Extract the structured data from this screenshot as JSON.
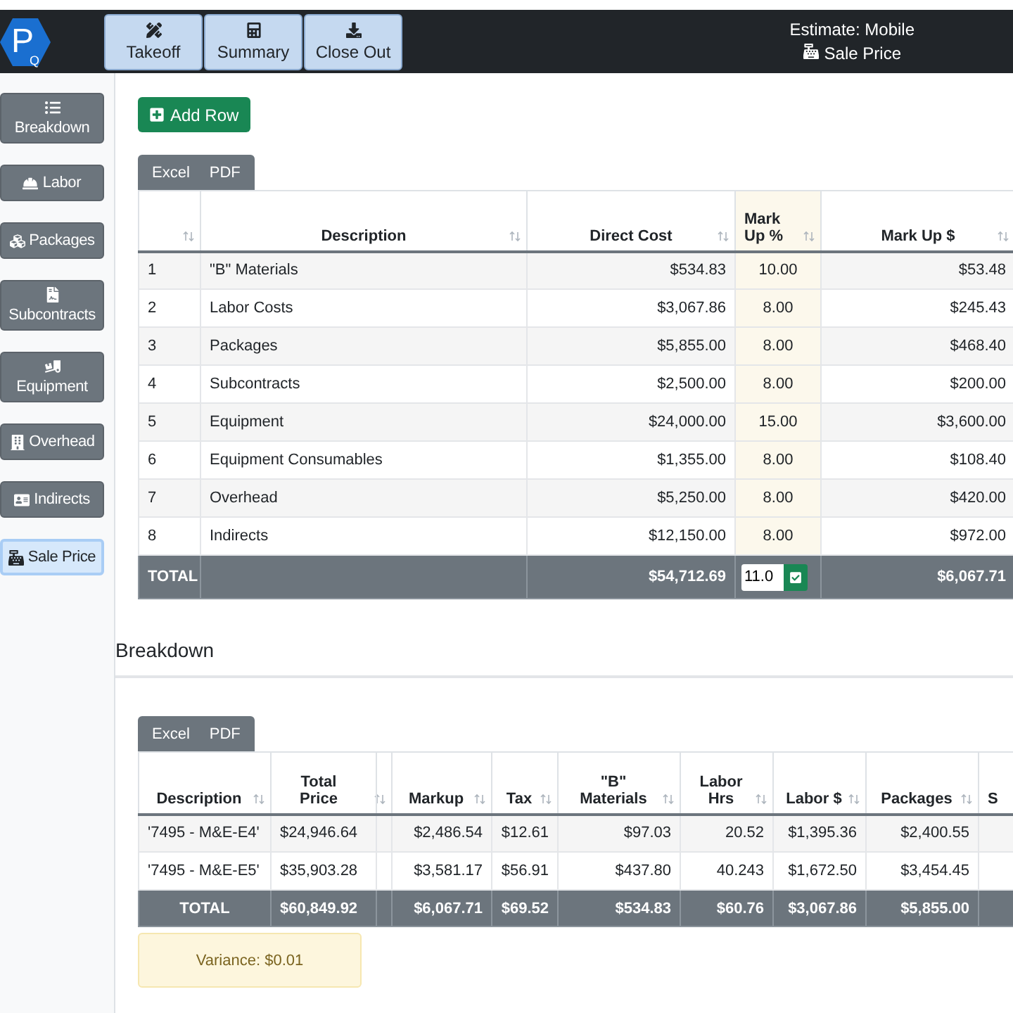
{
  "logo": {
    "letter": "P",
    "sub": "Q"
  },
  "nav": [
    {
      "label": "Takeoff",
      "selected": false
    },
    {
      "label": "Summary",
      "selected": false
    },
    {
      "label": "Close Out",
      "selected": false
    }
  ],
  "header": {
    "estimate": "Estimate: Mobile",
    "page": "Sale Price"
  },
  "sidebar": {
    "items": [
      {
        "label": "Breakdown",
        "kind": "stacked",
        "selected": false
      },
      {
        "label": "Labor",
        "kind": "inline",
        "selected": false
      },
      {
        "label": "Packages",
        "kind": "inline",
        "selected": false
      },
      {
        "label": "Subcontracts",
        "kind": "stacked",
        "selected": false
      },
      {
        "label": "Equipment",
        "kind": "stacked",
        "selected": false
      },
      {
        "label": "Overhead",
        "kind": "inline",
        "selected": false
      },
      {
        "label": "Indirects",
        "kind": "inline",
        "selected": false
      },
      {
        "label": "Sale Price",
        "kind": "inline",
        "selected": true
      }
    ]
  },
  "add_row": "Add Row",
  "markup_table": {
    "exports": [
      "Excel",
      "PDF"
    ],
    "columns": [
      {
        "kind": "index"
      },
      {
        "label": "Description",
        "kind": "text"
      },
      {
        "label": "Direct Cost",
        "kind": "money"
      },
      {
        "label": "Mark Up %",
        "kind": "editable"
      },
      {
        "label": "Mark Up $",
        "kind": "money"
      }
    ],
    "rows": [
      [
        "1",
        "\"B\" Materials",
        "$534.83",
        "10.00",
        "$53.48"
      ],
      [
        "2",
        "Labor Costs",
        "$3,067.86",
        "8.00",
        "$245.43"
      ],
      [
        "3",
        "Packages",
        "$5,855.00",
        "8.00",
        "$468.40"
      ],
      [
        "4",
        "Subcontracts",
        "$2,500.00",
        "8.00",
        "$200.00"
      ],
      [
        "5",
        "Equipment",
        "$24,000.00",
        "15.00",
        "$3,600.00"
      ],
      [
        "6",
        "Equipment Consumables",
        "$1,355.00",
        "8.00",
        "$108.40"
      ],
      [
        "7",
        "Overhead",
        "$5,250.00",
        "8.00",
        "$420.00"
      ],
      [
        "8",
        "Indirects",
        "$12,150.00",
        "8.00",
        "$972.00"
      ]
    ],
    "total": {
      "label": "TOTAL",
      "direct_cost": "$54,712.69",
      "markup_input": "11.0",
      "markup_dollars": "$6,067.71"
    }
  },
  "breakdown": {
    "title": "Breakdown",
    "exports": [
      "Excel",
      "PDF"
    ],
    "columns": [
      {
        "label": "Description",
        "kind": "text"
      },
      {
        "label": "Total Price",
        "kind": "split"
      },
      {
        "label": "Markup",
        "kind": "money"
      },
      {
        "label": "Tax",
        "kind": "money"
      },
      {
        "label": "\"B\" Materials",
        "kind": "money"
      },
      {
        "label": "Labor Hrs",
        "kind": "money"
      },
      {
        "label": "Labor $",
        "kind": "money"
      },
      {
        "label": "Packages",
        "kind": "money"
      },
      {
        "label": "S",
        "kind": "cut"
      }
    ],
    "rows": [
      [
        "'7495 - M&E-E4'",
        "$24,946.64",
        "$2,486.54",
        "$12.61",
        "$97.03",
        "20.52",
        "$1,395.36",
        "$2,400.55"
      ],
      [
        "'7495 - M&E-E5'",
        "$35,903.28",
        "$3,581.17",
        "$56.91",
        "$437.80",
        "40.243",
        "$1,672.50",
        "$3,454.45"
      ]
    ],
    "total": [
      "TOTAL",
      "$60,849.92",
      "$6,067.71",
      "$69.52",
      "$534.83",
      "$60.76",
      "$3,067.86",
      "$5,855.00"
    ],
    "variance": "Variance: $0.01"
  }
}
